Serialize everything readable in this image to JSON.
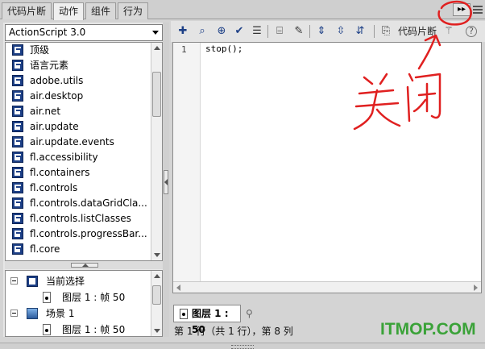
{
  "tabs": [
    {
      "label": "代码片断"
    },
    {
      "label": "动作",
      "active": true
    },
    {
      "label": "组件"
    },
    {
      "label": "行为"
    }
  ],
  "panel": {
    "collapse_label": "▸▸",
    "menu_icon": "panel-menu-icon"
  },
  "language_select": {
    "value": "ActionScript 3.0"
  },
  "library_items": [
    "顶级",
    "语言元素",
    "adobe.utils",
    "air.desktop",
    "air.net",
    "air.update",
    "air.update.events",
    "fl.accessibility",
    "fl.containers",
    "fl.controls",
    "fl.controls.dataGridCla...",
    "fl.controls.listClasses",
    "fl.controls.progressBar...",
    "fl.core"
  ],
  "scope_tree": {
    "current_selection": "当前选择",
    "current_frame": "图层 1 : 帧 50",
    "scene": "场景 1",
    "scene_frame": "图层 1 : 帧 50"
  },
  "toolbar": {
    "snippet_label": "代码片断",
    "icons": [
      "add-icon",
      "find-icon",
      "target-icon",
      "check-syntax-icon",
      "auto-format-icon",
      "code-hint-icon",
      "debug-options-icon",
      "collapse-between-icon",
      "collapse-selection-icon",
      "expand-all-icon",
      "snippets-icon",
      "wand-icon",
      "help-icon"
    ]
  },
  "editor": {
    "line_number": "1",
    "code": "stop();"
  },
  "script_tab": {
    "label": "图层 1 : 50"
  },
  "status": {
    "text": "第 1 行（共 1 行），第 8 列"
  },
  "annotation": {
    "handwritten_text": "关闭",
    "color": "#e02020"
  },
  "watermark": {
    "text": "ITMOP.COM",
    "color": "#3aa238"
  }
}
